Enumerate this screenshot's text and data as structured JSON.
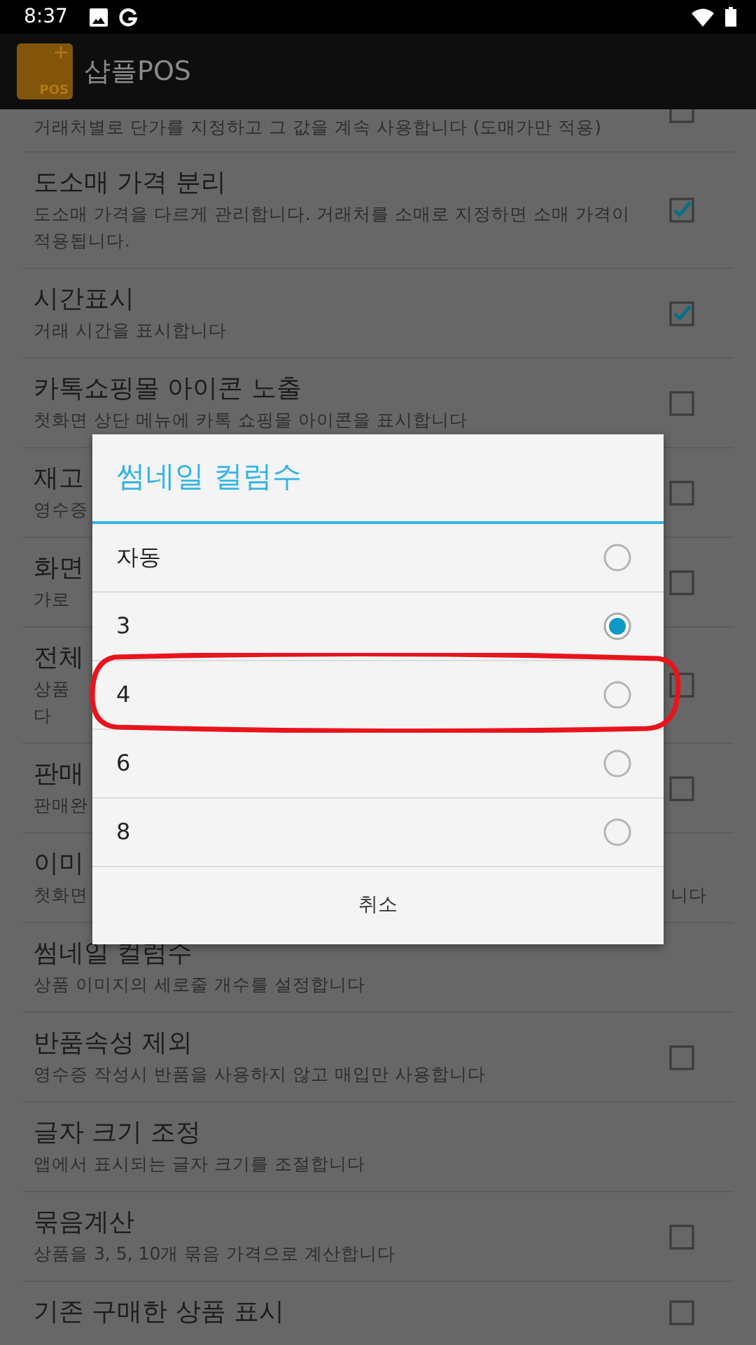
{
  "status_bar": {
    "time": "8:37"
  },
  "app_bar": {
    "title": "샵플POS",
    "logo_text": "POS"
  },
  "settings": [
    {
      "kind": "checkbox",
      "checked": false,
      "subtitle_lines": [
        "거래처별로 단가를 지정하고 그 값을 계속 사용합니다 (도매가만 적용)"
      ]
    },
    {
      "kind": "checkbox",
      "checked": true,
      "title": "도소매 가격 분리",
      "subtitle_lines": [
        "도소매 가격을 다르게 관리합니다. 거래처를 소매로 지정하면 소매 가격이",
        "적용됩니다."
      ]
    },
    {
      "kind": "checkbox",
      "checked": true,
      "title": "시간표시",
      "subtitle_lines": [
        "거래 시간을 표시합니다"
      ]
    },
    {
      "kind": "checkbox",
      "checked": false,
      "title": "카톡쇼핑몰 아이콘 노출",
      "subtitle_lines": [
        "첫화면 상단 메뉴에 카톡 쇼핑몰 아이콘을 표시합니다"
      ]
    },
    {
      "kind": "checkbox",
      "checked": false,
      "title": "재고",
      "subtitle_lines": [
        "영수증"
      ]
    },
    {
      "kind": "checkbox",
      "checked": false,
      "title": "화면",
      "subtitle_lines": [
        "가로"
      ]
    },
    {
      "kind": "checkbox",
      "checked": false,
      "title": "전체",
      "subtitle_lines": [
        "상품",
        "다"
      ]
    },
    {
      "kind": "checkbox",
      "checked": false,
      "title": "판매",
      "subtitle_lines": [
        "판매완"
      ]
    },
    {
      "kind": "text",
      "title": "이미",
      "subtitle_lines": [
        "첫화면"
      ],
      "subtitle_tail": "니다"
    },
    {
      "kind": "text",
      "title": "썸네일 컬럼수",
      "subtitle_lines": [
        "상품 이미지의 세로줄 개수를 설정합니다"
      ]
    },
    {
      "kind": "checkbox",
      "checked": false,
      "title": "반품속성 제외",
      "subtitle_lines": [
        "영수증 작성시 반품을 사용하지 않고 매입만 사용합니다"
      ]
    },
    {
      "kind": "text",
      "title": "글자 크기 조정",
      "subtitle_lines": [
        "앱에서 표시되는 글자 크기를 조절합니다"
      ]
    },
    {
      "kind": "checkbox",
      "checked": false,
      "title": "묶음계산",
      "subtitle_lines": [
        "상품을 3, 5, 10개 묶음 가격으로 계산합니다"
      ]
    },
    {
      "kind": "checkbox",
      "checked": false,
      "title": "기존 구매한 상품 표시"
    }
  ],
  "dialog": {
    "title": "썸네일 컬럼수",
    "options": [
      {
        "label": "자동",
        "selected": false,
        "highlighted": false
      },
      {
        "label": "3",
        "selected": true,
        "highlighted": false
      },
      {
        "label": "4",
        "selected": false,
        "highlighted": true
      },
      {
        "label": "6",
        "selected": false,
        "highlighted": false
      },
      {
        "label": "8",
        "selected": false,
        "highlighted": false
      }
    ],
    "cancel": "취소"
  }
}
